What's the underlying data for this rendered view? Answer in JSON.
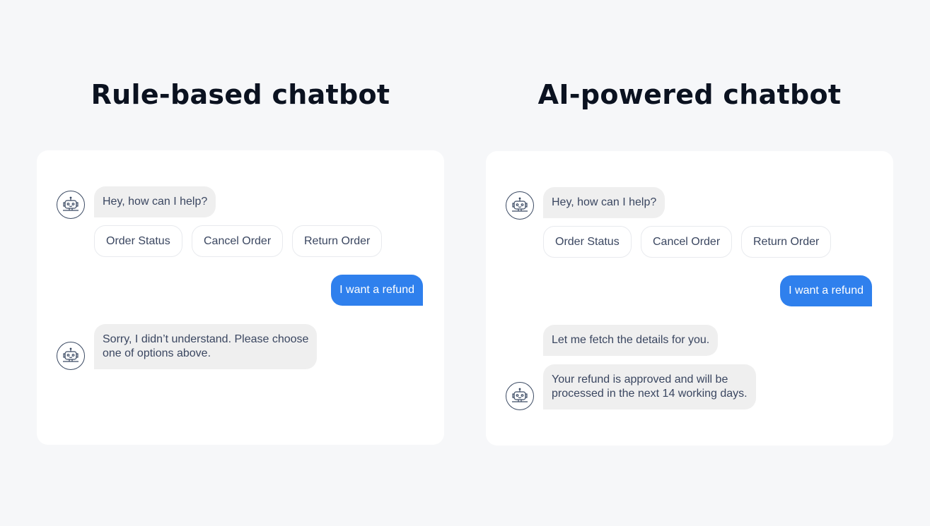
{
  "left": {
    "title": "Rule-based chatbot",
    "greeting": "Hey, how can I help?",
    "quick_replies": [
      "Order Status",
      "Cancel Order",
      "Return Order"
    ],
    "user_message": "I want a refund",
    "bot_reply_lines": [
      "Sorry, I didn’t understand. Please choose",
      "one of options above."
    ]
  },
  "right": {
    "title": "AI-powered chatbot",
    "greeting": "Hey, how can I help?",
    "quick_replies": [
      "Order Status",
      "Cancel Order",
      "Return Order"
    ],
    "user_message": "I want a refund",
    "bot_reply_1": "Let me fetch the details for you.",
    "bot_reply_2_lines": [
      "Your refund is approved and will be",
      "processed in the next 14 working days."
    ]
  },
  "colors": {
    "user_bubble": "#2f80ed",
    "bot_bubble": "#efefef",
    "background": "#f6f7f9",
    "title": "#0b1220"
  },
  "icons": {
    "bot_avatar": "robot-icon"
  }
}
